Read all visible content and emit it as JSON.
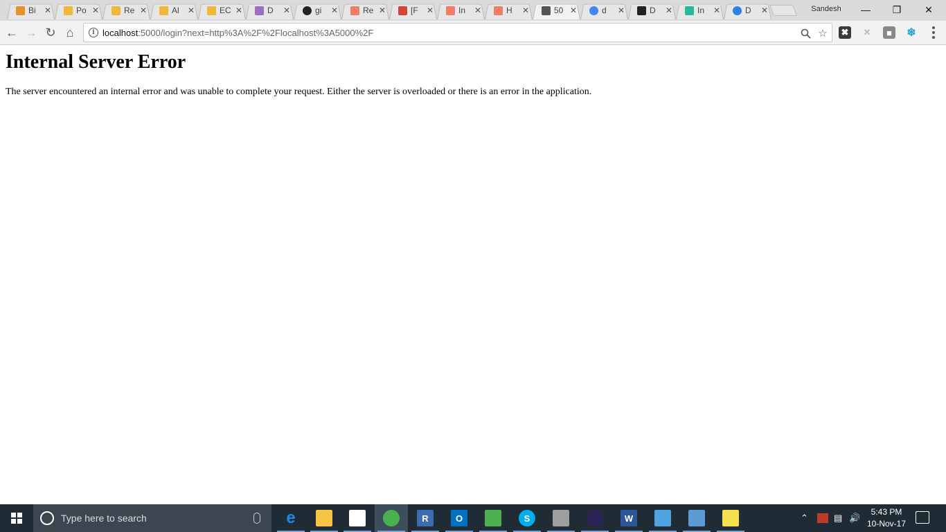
{
  "browser": {
    "tabs": [
      {
        "title": "Bi",
        "icon": "box-icon",
        "color": "#e8902c"
      },
      {
        "title": "Po",
        "icon": "box-icon",
        "color": "#f0b83a"
      },
      {
        "title": "Re",
        "icon": "box-icon",
        "color": "#f0b83a"
      },
      {
        "title": "Al",
        "icon": "box-icon",
        "color": "#f0b83a"
      },
      {
        "title": "EC",
        "icon": "box-icon",
        "color": "#f0b83a"
      },
      {
        "title": "D",
        "icon": "hexagon-icon",
        "color": "#9b6fc0"
      },
      {
        "title": "gi",
        "icon": "github-icon",
        "color": "#222222"
      },
      {
        "title": "Re",
        "icon": "bird-icon",
        "color": "#f07e66"
      },
      {
        "title": "[F",
        "icon": "gmail-icon",
        "color": "#d44638"
      },
      {
        "title": "In",
        "icon": "bird-icon",
        "color": "#f07e66"
      },
      {
        "title": "H",
        "icon": "bird-icon",
        "color": "#f07e66"
      },
      {
        "title": "50",
        "icon": "page-icon",
        "color": "#555555",
        "active": true
      },
      {
        "title": "d",
        "icon": "google-icon",
        "color": "#4285f4"
      },
      {
        "title": "D",
        "icon": "medium-icon",
        "color": "#222222"
      },
      {
        "title": "In",
        "icon": "vuetify-icon",
        "color": "#26b99a"
      },
      {
        "title": "D",
        "icon": "circle-icon",
        "color": "#2f80ed"
      }
    ],
    "profile_name": "Sandesh",
    "url_host": "localhost",
    "url_rest": ":5000/login?next=http%3A%2F%2Flocalhost%3A5000%2F"
  },
  "page": {
    "heading": "Internal Server Error",
    "message": "The server encountered an internal error and was unable to complete your request. Either the server is overloaded or there is an error in the application."
  },
  "taskbar": {
    "search_placeholder": "Type here to search",
    "apps": [
      {
        "name": "edge-icon",
        "label": "e",
        "color": "#1e88e5"
      },
      {
        "name": "file-explorer-icon",
        "label": "",
        "color": "#f6c343"
      },
      {
        "name": "store-icon",
        "label": "",
        "color": "#ffffff"
      },
      {
        "name": "chrome-icon",
        "label": "",
        "color": "#4caf50"
      },
      {
        "name": "r-icon",
        "label": "R",
        "color": "#3b6db5"
      },
      {
        "name": "outlook-icon",
        "label": "O",
        "color": "#0072c6"
      },
      {
        "name": "project-icon",
        "label": "",
        "color": "#4caf50"
      },
      {
        "name": "skype-icon",
        "label": "S",
        "color": "#00aff0"
      },
      {
        "name": "terminal-icon",
        "label": "",
        "color": "#9e9e9e"
      },
      {
        "name": "eclipse-icon",
        "label": "",
        "color": "#2c2255"
      },
      {
        "name": "word-icon",
        "label": "W",
        "color": "#2b579a"
      },
      {
        "name": "control-panel-icon",
        "label": "",
        "color": "#4fa3e0"
      },
      {
        "name": "network-icon",
        "label": "",
        "color": "#5c9bd6"
      },
      {
        "name": "notepad-icon",
        "label": "",
        "color": "#f4e04d"
      }
    ],
    "clock_time": "5:43 PM",
    "clock_date": "10-Nov-17"
  }
}
